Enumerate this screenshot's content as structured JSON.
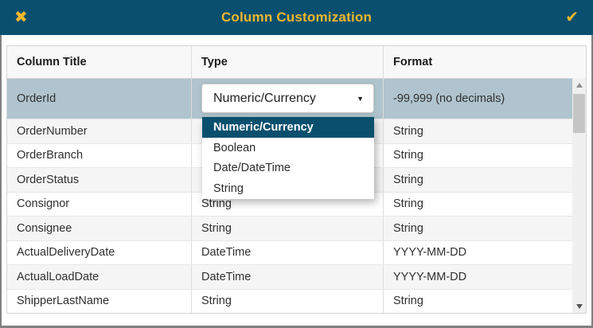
{
  "titlebar": {
    "title": "Column Customization",
    "close_icon": "✖",
    "confirm_icon": "✔"
  },
  "colors": {
    "titlebar_bg": "#0A506E",
    "accent_yellow": "#F1B72B",
    "selected_row_bg": "#AFC4CE",
    "alt_row_bg": "#F5F5F5",
    "edge_gray": "#808080"
  },
  "table": {
    "columns": [
      "Column Title",
      "Type",
      "Format"
    ],
    "rows": [
      {
        "title": "OrderId",
        "type": "Numeric/Currency",
        "format": "-99,999 (no decimals)",
        "selected": true
      },
      {
        "title": "OrderNumber",
        "type": "",
        "format": "String"
      },
      {
        "title": "OrderBranch",
        "type": "",
        "format": "String"
      },
      {
        "title": "OrderStatus",
        "type": "",
        "format": "String"
      },
      {
        "title": "Consignor",
        "type": "String",
        "format": "String"
      },
      {
        "title": "Consignee",
        "type": "String",
        "format": "String"
      },
      {
        "title": "ActualDeliveryDate",
        "type": "DateTime",
        "format": "YYYY-MM-DD"
      },
      {
        "title": "ActualLoadDate",
        "type": "DateTime",
        "format": "YYYY-MM-DD"
      },
      {
        "title": "ShipperLastName",
        "type": "String",
        "format": "String"
      }
    ]
  },
  "dropdown": {
    "value": "Numeric/Currency",
    "caret_icon": "▼",
    "options": [
      "Numeric/Currency",
      "Boolean",
      "Date/DateTime",
      "String"
    ],
    "highlighted_option": "Numeric/Currency"
  }
}
